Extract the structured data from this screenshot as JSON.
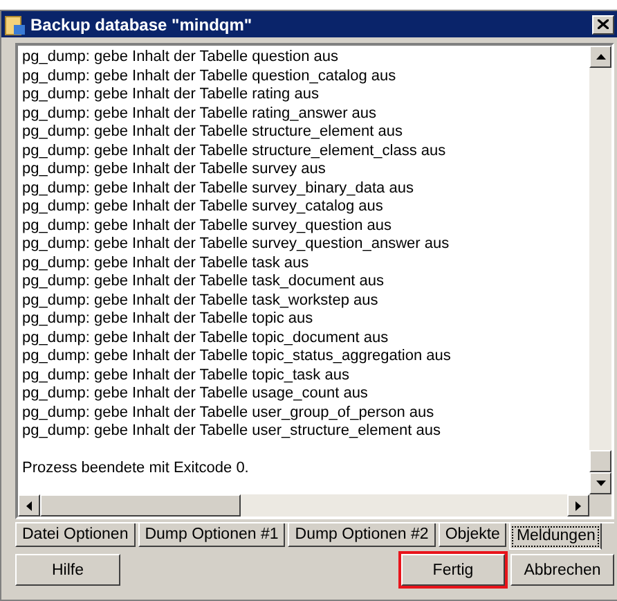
{
  "window": {
    "title": "Backup database \"mindqm\""
  },
  "log": {
    "lines": [
      "pg_dump: gebe Inhalt der Tabelle question aus",
      "pg_dump: gebe Inhalt der Tabelle question_catalog aus",
      "pg_dump: gebe Inhalt der Tabelle rating aus",
      "pg_dump: gebe Inhalt der Tabelle rating_answer aus",
      "pg_dump: gebe Inhalt der Tabelle structure_element aus",
      "pg_dump: gebe Inhalt der Tabelle structure_element_class aus",
      "pg_dump: gebe Inhalt der Tabelle survey aus",
      "pg_dump: gebe Inhalt der Tabelle survey_binary_data aus",
      "pg_dump: gebe Inhalt der Tabelle survey_catalog aus",
      "pg_dump: gebe Inhalt der Tabelle survey_question aus",
      "pg_dump: gebe Inhalt der Tabelle survey_question_answer aus",
      "pg_dump: gebe Inhalt der Tabelle task aus",
      "pg_dump: gebe Inhalt der Tabelle task_document aus",
      "pg_dump: gebe Inhalt der Tabelle task_workstep aus",
      "pg_dump: gebe Inhalt der Tabelle topic aus",
      "pg_dump: gebe Inhalt der Tabelle topic_document aus",
      "pg_dump: gebe Inhalt der Tabelle topic_status_aggregation aus",
      "pg_dump: gebe Inhalt der Tabelle topic_task aus",
      "pg_dump: gebe Inhalt der Tabelle usage_count aus",
      "pg_dump: gebe Inhalt der Tabelle user_group_of_person aus",
      "pg_dump: gebe Inhalt der Tabelle user_structure_element aus"
    ],
    "status": "Prozess beendete mit Exitcode 0."
  },
  "tabs": [
    {
      "label": "Datei Optionen",
      "selected": false
    },
    {
      "label": "Dump Optionen #1",
      "selected": false
    },
    {
      "label": "Dump Optionen #2",
      "selected": false
    },
    {
      "label": "Objekte",
      "selected": false
    },
    {
      "label": "Meldungen",
      "selected": true
    }
  ],
  "buttons": [
    {
      "label": "Hilfe",
      "kind": "left",
      "highlighted": false
    },
    {
      "label": "Fertig",
      "kind": "right",
      "highlighted": true
    },
    {
      "label": "Abbrechen",
      "kind": "right",
      "highlighted": false
    }
  ]
}
